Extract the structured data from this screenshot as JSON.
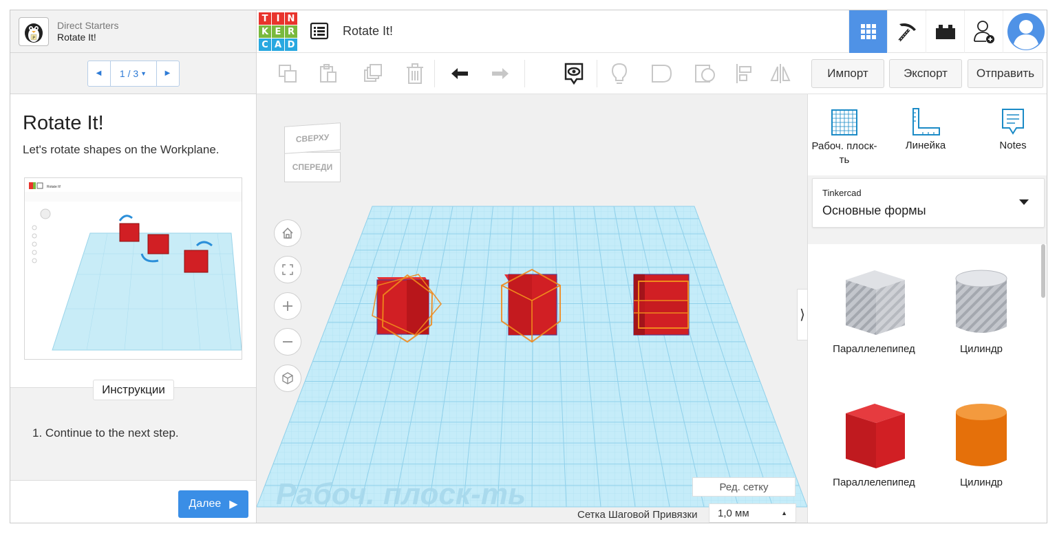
{
  "lesson_panel": {
    "category": "Direct Starters",
    "title": "Rotate It!",
    "pager": "1 / 3",
    "lesson_title": "Rotate It!",
    "description": "Let's rotate shapes on the Workplane.",
    "preview_title": "Rotate It!",
    "instructions_tab": "Инструкции",
    "instruction_step": "1. Continue to the next step.",
    "next_button": "Далее"
  },
  "header": {
    "logo_letters": [
      "T",
      "I",
      "N",
      "K",
      "E",
      "R",
      "C",
      "A",
      "D"
    ],
    "logo_colors": [
      "#e8342c",
      "#e8342c",
      "#e8342c",
      "#79b93d",
      "#79b93d",
      "#79b93d",
      "#28a8e0",
      "#28a8e0",
      "#28a8e0"
    ],
    "document_title": "Rotate It!",
    "icons": [
      "grid-view-icon",
      "pickaxe-icon",
      "bricks-icon",
      "add-user-icon",
      "profile-avatar-icon"
    ],
    "accent": "#4f92e6"
  },
  "toolbar": {
    "tools": [
      "copy-icon",
      "paste-icon",
      "duplicate-icon",
      "delete-icon",
      "undo-icon",
      "redo-icon",
      "notes-toggle-icon",
      "light-icon",
      "shape-outline-icon",
      "hole-icon",
      "align-icon",
      "mirror-icon"
    ],
    "import_label": "Импорт",
    "export_label": "Экспорт",
    "send_label": "Отправить"
  },
  "viewport": {
    "viewcube_top": "СВЕРХУ",
    "viewcube_front": "СПЕРЕДИ",
    "workplane_watermark": "Рабоч. плоск-ть",
    "edit_grid": "Ред. сетку",
    "snap_label": "Сетка Шаговой Привязки",
    "snap_value": "1,0 мм",
    "nav_buttons": [
      "home-icon",
      "fit-icon",
      "zoom-in-icon",
      "zoom-out-icon",
      "perspective-icon"
    ]
  },
  "right_panel": {
    "tools": [
      {
        "label": "Рабоч. плоск-ть",
        "icon": "workplane-icon"
      },
      {
        "label": "Линейка",
        "icon": "ruler-icon"
      },
      {
        "label": "Notes",
        "icon": "notes-icon"
      }
    ],
    "library_source": "Tinkercad",
    "library_selected": "Основные формы",
    "shapes": [
      {
        "label": "Параллелепипед",
        "style": "hole",
        "color": "#b9bcc2"
      },
      {
        "label": "Цилиндр",
        "style": "hole",
        "color": "#b9bcc2"
      },
      {
        "label": "Параллелепипед",
        "style": "solid",
        "color": "#d11f24"
      },
      {
        "label": "Цилиндр",
        "style": "solid",
        "color": "#ec7a10"
      }
    ]
  }
}
